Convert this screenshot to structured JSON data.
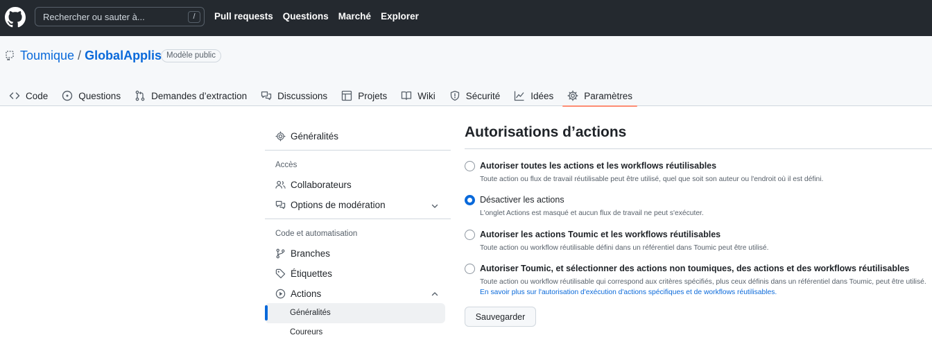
{
  "header": {
    "logo_icon": "github-mark-icon",
    "search_placeholder": "Rechercher ou sauter à...",
    "search_shortcut": "/",
    "nav": [
      "Pull requests",
      "Questions",
      "Marché",
      "Explorer"
    ]
  },
  "repo": {
    "icon": "repo-template-icon",
    "owner": "Toumique",
    "separator": "/",
    "name": "GlobalApplis",
    "badge": "Modèle public"
  },
  "tabs": [
    {
      "label": "Code",
      "icon": "code-icon"
    },
    {
      "label": "Questions",
      "icon": "issue-icon"
    },
    {
      "label": "Demandes d’extraction",
      "icon": "pull-request-icon"
    },
    {
      "label": "Discussions",
      "icon": "comment-discussion-icon"
    },
    {
      "label": "Projets",
      "icon": "table-icon"
    },
    {
      "label": "Wiki",
      "icon": "book-icon"
    },
    {
      "label": "Sécurité",
      "icon": "shield-icon"
    },
    {
      "label": "Idées",
      "icon": "graph-icon"
    },
    {
      "label": "Paramètres",
      "icon": "gear-icon",
      "selected": true
    }
  ],
  "sidebar": {
    "general": "Généralités",
    "access_heading": "Accès",
    "collaborators": "Collaborateurs",
    "moderation": "Options de modération",
    "code_heading": "Code et automatisation",
    "branches": "Branches",
    "tags": "Étiquettes",
    "actions": "Actions",
    "actions_sub": [
      "Généralités",
      "Coureurs"
    ]
  },
  "main": {
    "title": "Autorisations d’actions",
    "options": [
      {
        "label": "Autoriser toutes les actions et les workflows réutilisables",
        "desc": "Toute action ou flux de travail réutilisable peut être utilisé, quel que soit son auteur ou l'endroit où il est défini.",
        "checked": false
      },
      {
        "label": "Désactiver les actions",
        "desc": "L'onglet Actions est masqué et aucun flux de travail ne peut s'exécuter.",
        "checked": true
      },
      {
        "label": "Autoriser les actions Toumic et les workflows réutilisables",
        "desc": "Toute action ou workflow réutilisable défini dans un référentiel dans Toumic peut être utilisé.",
        "checked": false
      },
      {
        "label": "Autoriser Toumic, et sélectionner des actions non toumiques, des actions et des workflows réutilisables",
        "desc": "Toute action ou workflow réutilisable qui correspond aux critères spécifiés, plus ceux définis dans un référentiel dans Toumic, peut être utilisé.",
        "link": "En savoir plus sur l'autorisation d'exécution d'actions spécifiques et de workflows réutilisables.",
        "checked": false
      }
    ],
    "save_label": "Sauvegarder"
  },
  "colors": {
    "header_bg": "#24292f",
    "accent": "#0969da",
    "selected_tab_underline": "#fd8c73"
  }
}
